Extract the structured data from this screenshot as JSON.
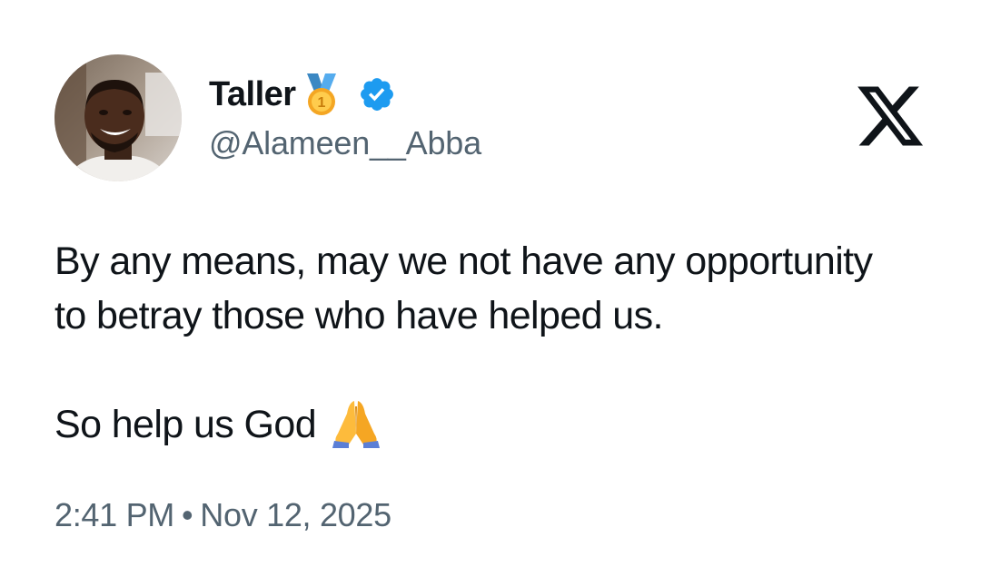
{
  "user": {
    "display_name": "Taller",
    "handle": "@Alameen__Abba",
    "badge_icon": "gold-medal-icon",
    "verified_icon": "verified-badge-icon",
    "verified_color": "#1d9bf0"
  },
  "tweet": {
    "line1": "By any means, may we not have any opportunity",
    "line2": "to betray those who have helped us.",
    "line3": "So help us God",
    "emoji_icon": "praying-hands-icon"
  },
  "meta": {
    "time": "2:41 PM",
    "separator": "•",
    "date": "Nov 12, 2025"
  },
  "brand": {
    "logo_icon": "x-logo-icon",
    "text_color": "#0f1419",
    "muted_color": "#536471"
  }
}
